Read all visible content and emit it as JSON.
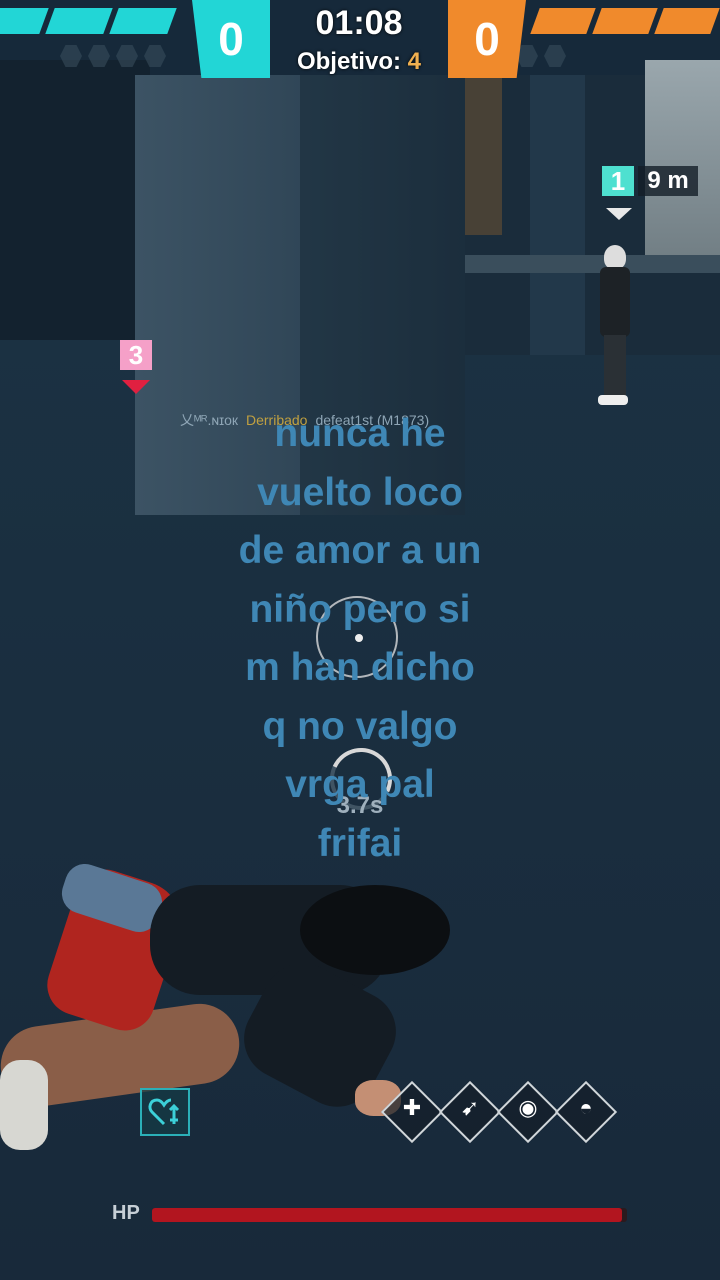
{
  "hud": {
    "team_left_score": "0",
    "team_right_score": "0",
    "timer": "01:08",
    "objective_label": "Objetivo:",
    "objective_value": "4",
    "team_left_color": "#22d6d6",
    "team_right_color": "#f08a2c"
  },
  "markers": {
    "ally_number": "1",
    "ally_distance": "9 m",
    "enemy_number": "3"
  },
  "killfeed": {
    "killer": "乂ᴹᴿ.ɴɪᴏк",
    "action": "Derribado",
    "victim": "defeat1st",
    "weapon": "(M1873)"
  },
  "caption": {
    "line1": "nunca he",
    "line2": "vuelto loco",
    "line3": "de amor a un",
    "line4": "niño pero si",
    "line5": "m han dicho",
    "line6": "q no valgo",
    "line7": "vrga pal",
    "line8": "frifai"
  },
  "revive": {
    "timer": "3.7s",
    "progress": 0.3
  },
  "skills": {
    "heal_icon": "heal-heart-icon",
    "slots": [
      "hp-skill-icon",
      "running-skill-icon",
      "eye-skill-icon",
      "dome-shield-icon"
    ]
  },
  "status": {
    "hp_label": "HP",
    "hp_fraction": 0.99
  }
}
